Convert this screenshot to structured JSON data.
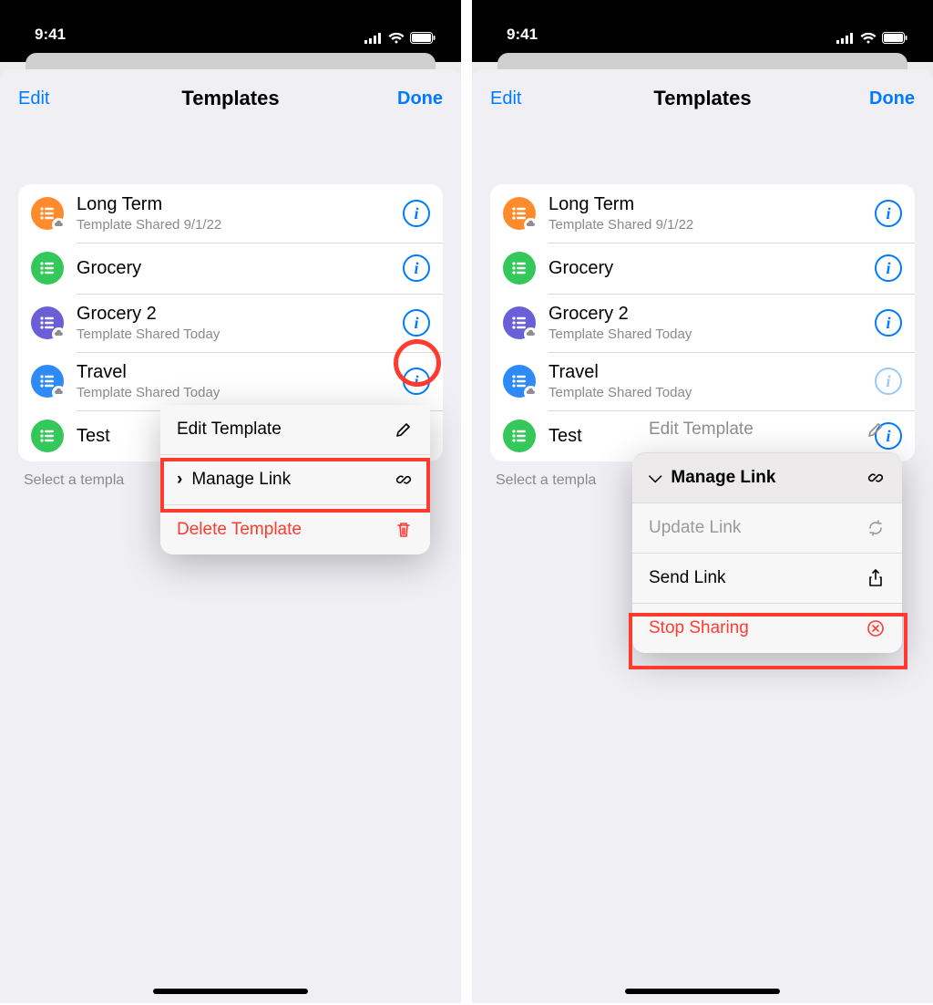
{
  "status": {
    "time": "9:41"
  },
  "nav": {
    "edit": "Edit",
    "title": "Templates",
    "done": "Done"
  },
  "hint": "Select a templa",
  "colors": {
    "orange": "#ff8b2c",
    "green": "#34c759",
    "purple": "#6b5fd8",
    "blue": "#2d8af7",
    "green2": "#34c759"
  },
  "templates": [
    {
      "title": "Long Term",
      "sub": "Template Shared 9/1/22",
      "shared": true,
      "color": "orange"
    },
    {
      "title": "Grocery",
      "sub": "",
      "shared": false,
      "color": "green"
    },
    {
      "title": "Grocery 2",
      "sub": "Template Shared Today",
      "shared": true,
      "color": "purple"
    },
    {
      "title": "Travel",
      "sub": "Template Shared Today",
      "shared": true,
      "color": "blue"
    },
    {
      "title": "Test",
      "sub": "",
      "shared": false,
      "color": "green2"
    }
  ],
  "popoverA": {
    "edit": "Edit Template",
    "manage": "Manage Link",
    "delete": "Delete Template"
  },
  "popoverB": {
    "ghost": "Edit Template",
    "header": "Manage Link",
    "update": "Update Link",
    "send": "Send Link",
    "stop": "Stop Sharing"
  }
}
